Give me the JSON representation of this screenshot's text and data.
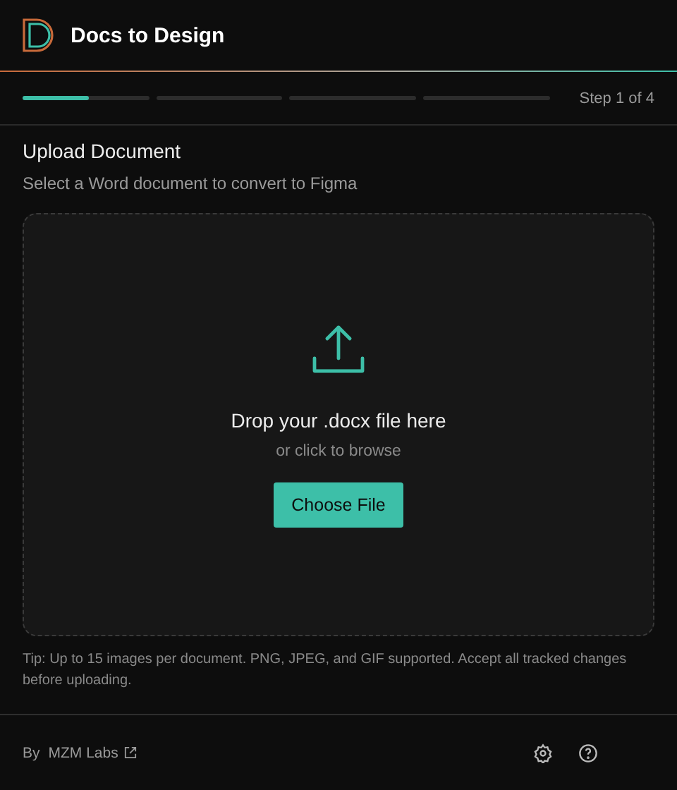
{
  "header": {
    "title": "Docs to Design"
  },
  "progress": {
    "level": 0.125,
    "label": "Step 1 of 4"
  },
  "section": {
    "title": "Upload Document",
    "subtitle": "Select a Word document to convert to Figma"
  },
  "dropzone": {
    "heading": "Drop your .docx file here",
    "hint": "or click to browse",
    "button": "Choose File"
  },
  "tip": "Tip: Up to 15 images per document. PNG, JPEG, and GIF supported. Accept all tracked changes before uploading.",
  "footer": {
    "by": "By",
    "link": "MZM Labs"
  }
}
